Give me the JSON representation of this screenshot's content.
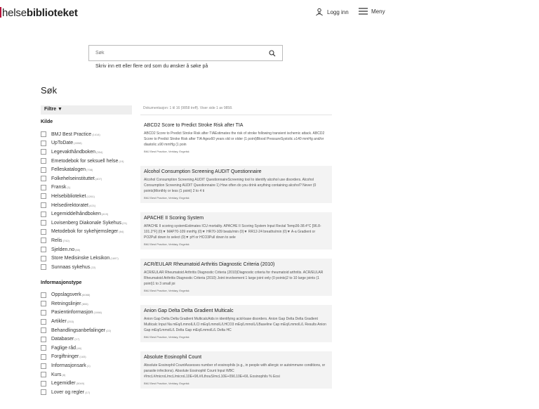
{
  "header": {
    "logo_a": "helse",
    "logo_b": "biblioteket",
    "login_label": "Logg inn",
    "menu_label": "Meny"
  },
  "search": {
    "placeholder": "Søk",
    "hint": "Skriv inn ett eller flere ord som du ønsker å søke på"
  },
  "page_title": "Søk",
  "sidebar": {
    "filter_label": "Filtre ▼",
    "groups": [
      {
        "title": "Kilde",
        "items": [
          {
            "label": "BMJ Best Practice",
            "count": "(1414)"
          },
          {
            "label": "UpToDate",
            "count": "(4008)"
          },
          {
            "label": "Legevakthåndboken",
            "count": "(354)"
          },
          {
            "label": "Emetodebok for seksuell helse",
            "count": "(19)"
          },
          {
            "label": "Felleskatalogen",
            "count": "(708)"
          },
          {
            "label": "Folkehelseinstituttet",
            "count": "(407)"
          },
          {
            "label": "Fransk",
            "count": "(1)"
          },
          {
            "label": "Helsebiblioteket",
            "count": "(1261)"
          },
          {
            "label": "Helsedirektoratet",
            "count": "(421)"
          },
          {
            "label": "Legemiddelhåndboken",
            "count": "(419)"
          },
          {
            "label": "Lovisenberg Diakonale Sykehus",
            "count": "(21)"
          },
          {
            "label": "Metodebok for sykehjemsleger",
            "count": "(84)"
          },
          {
            "label": "Relis",
            "count": "(742)"
          },
          {
            "label": "Sjelden.no",
            "count": "(88)"
          },
          {
            "label": "Store Medisinske Leksikon",
            "count": "(1697)"
          },
          {
            "label": "Sunnaas sykehus",
            "count": "(22)"
          }
        ]
      },
      {
        "title": "Informasjonstype",
        "items": [
          {
            "label": "Oppslagsverk",
            "count": "(6088)"
          },
          {
            "label": "Retningslinjer",
            "count": "(806)"
          },
          {
            "label": "Pasientinformasjon",
            "count": "(1066)"
          },
          {
            "label": "Artikler",
            "count": "(253)"
          },
          {
            "label": "Behandlingsanbefalinger",
            "count": "(22)"
          },
          {
            "label": "Databaser",
            "count": "(17)"
          },
          {
            "label": "Faglige råd",
            "count": "(46)"
          },
          {
            "label": "Forgiftninger",
            "count": "(183)"
          },
          {
            "label": "Informasjonsark",
            "count": "(1)"
          },
          {
            "label": "Kurs",
            "count": "(8)"
          },
          {
            "label": "Legemidler",
            "count": "(5049)"
          },
          {
            "label": "Lover og regler",
            "count": "(17)"
          }
        ]
      }
    ]
  },
  "results": {
    "count_text": "Dokumentasjon: 1 til 16 (9858 treff). Viser side 1 av 9858.",
    "items": [
      {
        "title": "ABCD2 Score to Predict Stroke Risk after TIA",
        "desc": "ABCD2 Score to Predict Stroke Risk after TIAEstimates the risk of stroke following transient ischemic attack. ABCD2 Score to Predict Stroke Risk after TIA Age≥60 years old or older (1 point)Blood PressureSystolic ≥140 mmHg and/or diastolic ≥90 mmHg (1 poin",
        "meta": "BMJ Best Practice, Verktøy, Engelsk"
      },
      {
        "title": "Alcohol Consumption Screening AUDIT Questionnaire",
        "desc": "Alcohol Consumption Screening AUDIT QuestionnaireScreening tool to identify alcohol use disorders. Alcohol Consumption Screening AUDIT Questionnaire 1) How often do you drink anything containing alcohol? Never (0 points)Monthly or less (1 point) 2 to 4 ti",
        "meta": "BMJ Best Practice, Verktøy, Engelsk"
      },
      {
        "title": "APACHE II Scoring System",
        "desc": "APACHE II scoring systemEstimates ICU mortality. APACHE II Scoring System Input Rectal Temp36-38.4°C [96.8-101.2°F] (0)▼ MAP70-109 mmHg (0)▼ HR70-109 beats/min (0)▼ RR12-24 breaths/min (0)▼ A-a Gradient or PO2Pull down to select (0)▼ pH or HCO3Pull down to sele",
        "meta": "BMJ Best Practice, Verktøy, Engelsk"
      },
      {
        "title": "ACR/EULAR Rheumatoid Arthritis Diagnostic Criteria (2010)",
        "desc": "ACR/EULAR Rheumatoid Arthritis Diagnostic Criteria (2010)Diagnostic criteria for rheumatoid arthritis. ACR/EULAR Rheumatoid Arthritis Diagnostic Criteria (2010) Joint involvement 1 large joint only (0 points)2 to 10 large joints (1 point)1 to 3 small joi",
        "meta": "BMJ Best Practice, Verktøy, Engelsk"
      },
      {
        "title": "Anion Gap Delta Delta Gradient Multicalc",
        "desc": "Anion Gap Delta Delta Gradient MulticalcAids in identifying acid-base disorders. Anion Gap Delta Delta Gradient Multicalc Input Na mEq/LmmolL/LCl mEq/LmmolL/LHCO3 mEq/LmmolL/LBaseline Cap mEq/LmmolL/L Results Anion Gap mEq/LmmolL/L Delta Gap mEq/LmmolL/L Delta HC",
        "meta": "BMJ Best Practice, Verktøy, Engelsk"
      },
      {
        "title": "Absolute Eosinophil Count",
        "desc": "Absolute Eosinophil CountAssesses number of eosinophils (e.g., in people with allergic or autoimmune conditions, or parasite infections). Absolute Eosinophil Count Input WBC #/mcL#/microL/mcL/microL10E+9/L#/LthouS/mcL10E+09/L10E+6/L Eosinophils % Eosi",
        "meta": "BMJ Best Practice, Verktøy, Engelsk"
      }
    ]
  }
}
